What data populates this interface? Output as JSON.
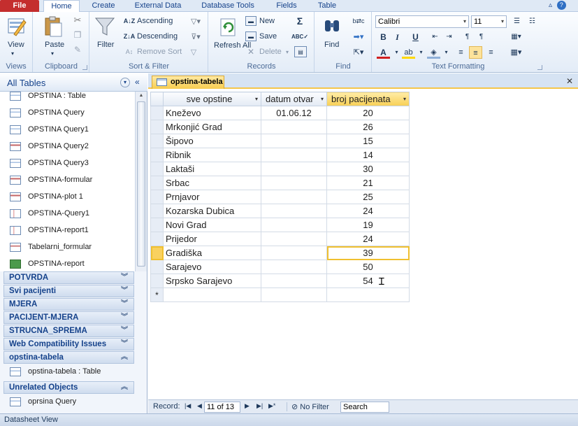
{
  "tabs": [
    "File",
    "Home",
    "Create",
    "External Data",
    "Database Tools",
    "Fields",
    "Table"
  ],
  "ribbon": {
    "views": {
      "view_label": "View",
      "group": "Views"
    },
    "clipboard": {
      "paste_label": "Paste",
      "group": "Clipboard"
    },
    "sort_filter": {
      "filter_label": "Filter",
      "ascending": "Ascending",
      "descending": "Descending",
      "remove_sort": "Remove Sort",
      "group": "Sort & Filter"
    },
    "records": {
      "refresh_label": "Refresh All",
      "new_label": "New",
      "save_label": "Save",
      "delete_label": "Delete",
      "group": "Records"
    },
    "find": {
      "find_label": "Find",
      "group": "Find"
    },
    "text_formatting": {
      "font": "Calibri",
      "size": "11",
      "group": "Text Formatting"
    }
  },
  "nav": {
    "title": "All Tables",
    "items": [
      {
        "label": "OPSTINA : Table",
        "icon": "table"
      },
      {
        "label": "OPSTINA Query",
        "icon": "query"
      },
      {
        "label": "OPSTINA Query1",
        "icon": "query"
      },
      {
        "label": "OPSTINA Query2",
        "icon": "form"
      },
      {
        "label": "OPSTINA Query3",
        "icon": "query"
      },
      {
        "label": "OPSTINA-formular",
        "icon": "form"
      },
      {
        "label": "OPSTINA-plot 1",
        "icon": "form"
      },
      {
        "label": "OPSTINA-Query1",
        "icon": "report"
      },
      {
        "label": "OPSTINA-report1",
        "icon": "report"
      },
      {
        "label": "Tabelarni_formular",
        "icon": "form"
      },
      {
        "label": "OPSTINA-report",
        "icon": "macro"
      }
    ],
    "sections": [
      "POTVRDA",
      "Svi pacijenti",
      "MJERA",
      "PACIJENT-MJERA",
      "STRUCNA_SPREMA",
      "Web Compatibility Issues",
      "opstina-tabela",
      "Unrelated Objects"
    ],
    "opstina_item": "opstina-tabela : Table",
    "unrelated_item": "oprsina Query"
  },
  "document": {
    "tab_title": "opstina-tabela",
    "columns": [
      "sve opstine",
      "datum otvar",
      "broj pacijenata"
    ],
    "rows": [
      [
        "Kneževo",
        "01.06.12",
        "20"
      ],
      [
        "Mrkonjić Grad",
        "",
        "26"
      ],
      [
        "Šipovo",
        "",
        "15"
      ],
      [
        "Ribnik",
        "",
        "14"
      ],
      [
        "Laktaši",
        "",
        "30"
      ],
      [
        "Srbac",
        "",
        "21"
      ],
      [
        "Prnjavor",
        "",
        "25"
      ],
      [
        "Kozarska Dubica",
        "",
        "24"
      ],
      [
        "Novi Grad",
        "",
        "19"
      ],
      [
        "Prijedor",
        "",
        "24"
      ],
      [
        "Gradiška",
        "",
        "39"
      ],
      [
        "Sarajevo",
        "",
        "50"
      ],
      [
        "Srpsko Sarajevo",
        "",
        "54"
      ]
    ],
    "new_row_marker": "*"
  },
  "record_nav": {
    "label": "Record:",
    "position": "11 of 13",
    "filter": "No Filter",
    "search": "Search"
  },
  "status": "Datasheet View"
}
